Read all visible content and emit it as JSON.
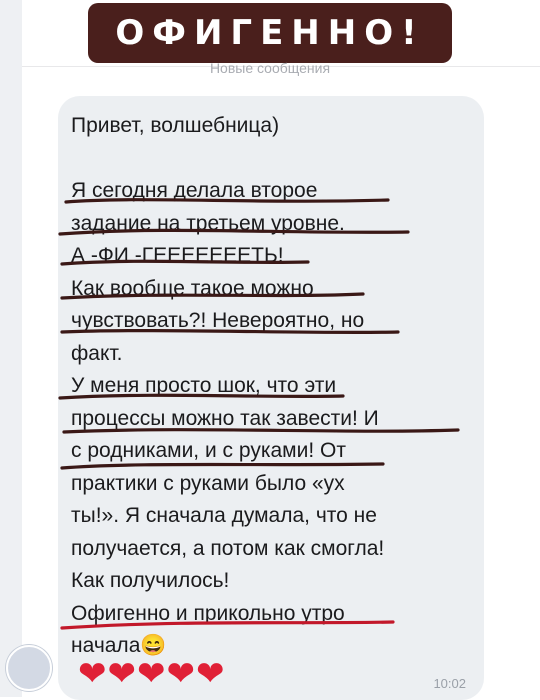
{
  "banner": {
    "text": "ОФИГЕННО!"
  },
  "divider": {
    "label": "Новые сообщения"
  },
  "message": {
    "lines": [
      "Привет, волшебница)",
      "",
      "Я сегодня делала второе",
      "задание на третьем уровне.",
      "А -ФИ -ГЕЕЕЕЕЕЕТЬ!",
      "Как вообще такое можно",
      "чувствовать?! Невероятно, но",
      "факт.",
      "У меня просто шок, что эти",
      "процессы можно так завести! И",
      "с родниками, и с руками! От",
      "практики с руками было «ух",
      "ты!». Я сначала думала, что не",
      "получается, а потом как смогла!",
      "Как получилось!",
      "Офигенно и прикольно утро",
      "начала😄"
    ],
    "hearts": "❤❤❤❤❤",
    "time": "10:02"
  },
  "colors": {
    "banner_bg": "#4a1f1c",
    "bubble_bg": "#eceff2",
    "underline_dark": "#3a1816",
    "underline_red": "#c2182a",
    "heart": "#e02036"
  }
}
